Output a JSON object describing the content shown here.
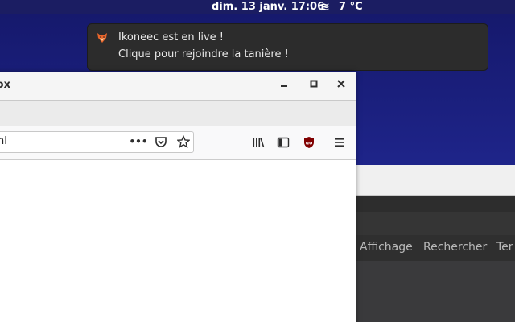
{
  "topbar": {
    "clock": "dim. 13 janv.  17:06",
    "weather_icon": "≋",
    "temperature": "7 °C"
  },
  "notification": {
    "icon": "ikoneec-fox-icon",
    "title": "Ikoneec est en live !",
    "body": "Clique pour rejoindre la tanière !"
  },
  "firefox": {
    "title_fragment": "fox",
    "url_fragment": "nl",
    "url_actions": "•••",
    "icons": [
      "library-icon",
      "sidebar-icon",
      "ublock-icon",
      "hamburger-menu-icon"
    ]
  },
  "background_window": {
    "menu": [
      "Affichage",
      "Rechercher",
      "Ter"
    ]
  },
  "colors": {
    "desktop": "#1e2489",
    "topbar": "#1b1d62",
    "notification": "#2c2c2c",
    "ublock": "#800000"
  }
}
